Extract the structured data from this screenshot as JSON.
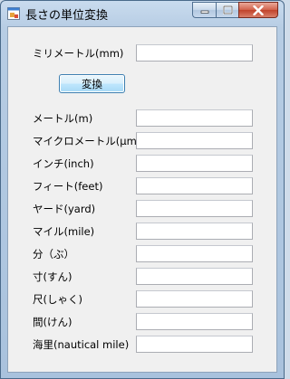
{
  "window": {
    "title": "長さの単位変換",
    "controls": {
      "minimize": "minimize-icon",
      "maximize": "maximize-icon",
      "close": "close-icon"
    }
  },
  "input": {
    "label": "ミリメートル(mm)",
    "value": ""
  },
  "convert_button": "変換",
  "outputs": [
    {
      "label": "メートル(m)",
      "value": ""
    },
    {
      "label": "マイクロメートル(μm)",
      "value": ""
    },
    {
      "label": "インチ(inch)",
      "value": ""
    },
    {
      "label": "フィート(feet)",
      "value": ""
    },
    {
      "label": "ヤード(yard)",
      "value": ""
    },
    {
      "label": "マイル(mile)",
      "value": ""
    },
    {
      "label": "分（ぶ）",
      "value": ""
    },
    {
      "label": "寸(すん)",
      "value": ""
    },
    {
      "label": "尺(しゃく)",
      "value": ""
    },
    {
      "label": "間(けん)",
      "value": ""
    },
    {
      "label": "海里(nautical mile)",
      "value": ""
    }
  ],
  "colors": {
    "client_bg": "#f0f0f0",
    "close_button": "#c0432b",
    "button_border": "#3c7fb1"
  }
}
